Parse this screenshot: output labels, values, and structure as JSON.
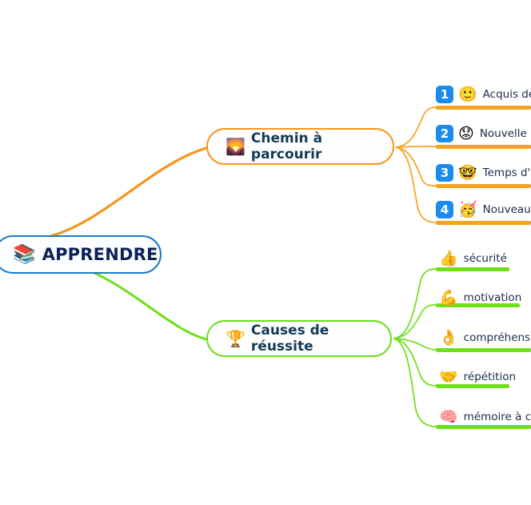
{
  "mindmap": {
    "title": "APPRENDRE",
    "root": {
      "label": "APPRENDRE",
      "emoji": "📚",
      "emoji_name": "books-icon",
      "border_color": "#1f7ac4",
      "text_color": "#0d2259"
    },
    "branches": [
      {
        "id": "chemin",
        "label": "Chemin à parcourir",
        "emoji": "🌄",
        "emoji_name": "sunrise-over-mountains-icon",
        "color": "#f7941d",
        "children": [
          {
            "number": "1",
            "emoji": "🙂",
            "emoji_name": "slightly-smiling-face-icon",
            "label": "Acquis de"
          },
          {
            "number": "2",
            "emoji": "😟",
            "emoji_name": "worried-face-icon",
            "label": "Nouvelle le"
          },
          {
            "number": "3",
            "emoji": "🤓",
            "emoji_name": "nerd-face-icon",
            "label": "Temps d'a"
          },
          {
            "number": "4",
            "emoji": "🥳",
            "emoji_name": "partying-face-icon",
            "label": "Nouveaux"
          }
        ]
      },
      {
        "id": "causes",
        "label": "Causes de réussite",
        "emoji": "🏆",
        "emoji_name": "trophy-icon",
        "color": "#68e01a",
        "children": [
          {
            "number": "",
            "emoji": "👍",
            "emoji_name": "thumbs-up-icon",
            "label": "sécurité"
          },
          {
            "number": "",
            "emoji": "💪",
            "emoji_name": "flexed-biceps-icon",
            "label": "motivation"
          },
          {
            "number": "",
            "emoji": "👌",
            "emoji_name": "ok-hand-icon",
            "label": "compréhension"
          },
          {
            "number": "",
            "emoji": "🤝",
            "emoji_name": "handshake-icon",
            "label": "répétition"
          },
          {
            "number": "",
            "emoji": "🧠",
            "emoji_name": "brain-icon",
            "label": "mémoire à cour"
          }
        ]
      }
    ],
    "colors": {
      "orange": "#f7941d",
      "orange_underline": "#f7a120",
      "green": "#68e01a",
      "green_underline": "#6de01a",
      "blue": "#1f7ac4",
      "badge_blue": "#1a8cf0",
      "root_text": "#0d2259",
      "branch_text": "#123a54",
      "leaf_text": "#1b2a4a",
      "background": "#ffffff"
    }
  }
}
